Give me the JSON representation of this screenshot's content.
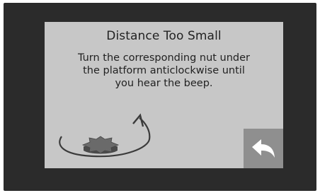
{
  "dialog": {
    "title": "Distance Too Small",
    "message_lines": [
      "Turn the corresponding nut under",
      "the platform anticlockwise until",
      "you hear the beep."
    ]
  },
  "icons": {
    "illustration": "nut-rotate-anticlockwise-icon",
    "back": "back-arrow-icon"
  },
  "colors": {
    "frame": "#2b2b2b",
    "panel": "#c7c7c7",
    "back_button": "#8f8f8f",
    "text": "#222222"
  }
}
